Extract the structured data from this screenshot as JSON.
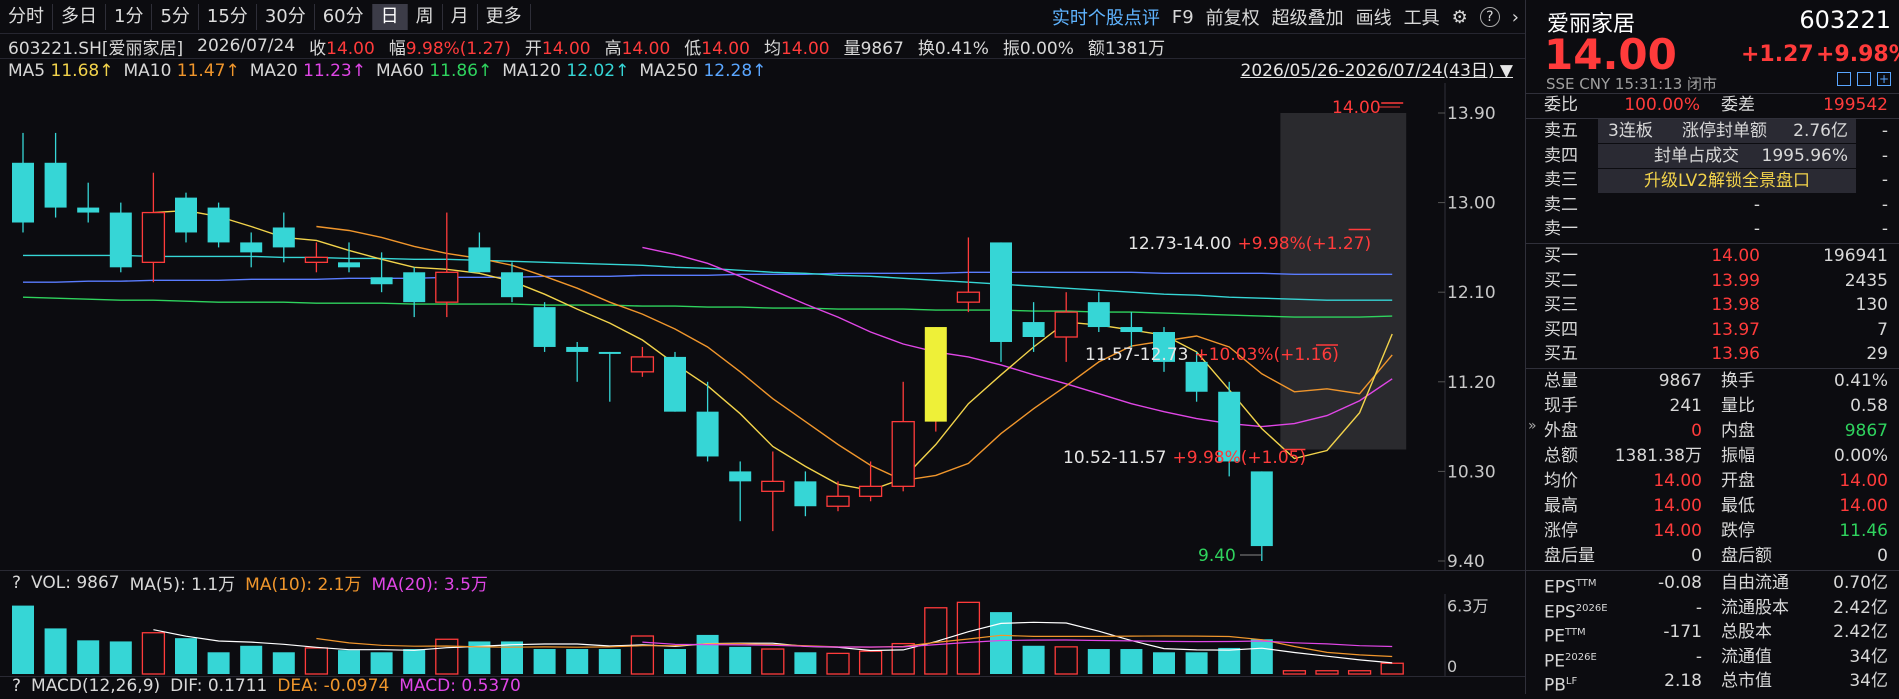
{
  "toolbar": {
    "periods": [
      "分时",
      "多日",
      "1分",
      "5分",
      "15分",
      "30分",
      "60分",
      "日",
      "周",
      "月",
      "更多"
    ],
    "active_period": "日",
    "right_items": [
      "实时个股点评",
      "F9",
      "前复权",
      "超级叠加",
      "画线",
      "工具"
    ]
  },
  "info": {
    "code": "603221.SH[爱丽家居]",
    "date": "2026/07/24",
    "close_label": "收",
    "close": "14.00",
    "amp_label": "幅",
    "amp": "9.98%(1.27)",
    "open_label": "开",
    "open": "14.00",
    "high_label": "高",
    "high": "14.00",
    "low_label": "低",
    "low": "14.00",
    "avg_label": "均",
    "avg": "14.00",
    "vol_label": "量",
    "vol": "9867",
    "turn_label": "换",
    "turn": "0.41%",
    "swing_label": "振",
    "swing": "0.00%",
    "amount_label": "额",
    "amount": "1381万"
  },
  "ma": {
    "ma5": "MA5",
    "ma5_val": "11.68↑",
    "ma10": "MA10",
    "ma10_val": "11.47↑",
    "ma20": "MA20",
    "ma20_val": "11.23↑",
    "ma60": "MA60",
    "ma60_val": "11.86↑",
    "ma120": "MA120",
    "ma120_val": "12.02↑",
    "ma250": "MA250",
    "ma250_val": "12.28↑",
    "range": "2026/05/26-2026/07/24(43日)"
  },
  "annotations": {
    "top": "14.00",
    "r1": "12.73-14.00",
    "r1p": "+9.98%(+1.27)",
    "r2": "11.57-12.73",
    "r2p": "+10.03%(+1.16)",
    "r3": "10.52-11.57",
    "r3p": "+9.98%(+1.05)",
    "bottom": "9.40"
  },
  "colors": {
    "up": "#ff3b3b",
    "down": "#36d6d6",
    "ma5": "#f2d34b",
    "ma10": "#f0962c",
    "ma20": "#e046e6",
    "ma60": "#2fd35e",
    "ma120": "#36d6d6",
    "ma250": "#5a7cff"
  },
  "chart_data": {
    "type": "candlestick",
    "y_ticks": [
      13.9,
      13.0,
      12.1,
      11.2,
      10.3,
      9.4
    ],
    "candles": [
      [
        13.4,
        12.8,
        13.7,
        12.7
      ],
      [
        13.4,
        12.95,
        13.7,
        12.85
      ],
      [
        12.95,
        12.9,
        13.2,
        12.8
      ],
      [
        12.9,
        12.35,
        13.0,
        12.3
      ],
      [
        12.4,
        12.9,
        13.3,
        12.2
      ],
      [
        13.05,
        12.7,
        13.1,
        12.6
      ],
      [
        12.95,
        12.6,
        13.0,
        12.55
      ],
      [
        12.6,
        12.5,
        12.7,
        12.35
      ],
      [
        12.75,
        12.55,
        12.9,
        12.4
      ],
      [
        12.4,
        12.45,
        12.6,
        12.3
      ],
      [
        12.4,
        12.35,
        12.6,
        12.3
      ],
      [
        12.25,
        12.18,
        12.5,
        12.1
      ],
      [
        12.3,
        12.0,
        12.35,
        11.85
      ],
      [
        12.0,
        12.3,
        12.9,
        11.85
      ],
      [
        12.55,
        12.3,
        12.7,
        12.3
      ],
      [
        12.3,
        12.05,
        12.4,
        12.0
      ],
      [
        11.95,
        11.55,
        12.0,
        11.5
      ],
      [
        11.55,
        11.5,
        11.6,
        11.2
      ],
      [
        11.5,
        11.48,
        11.5,
        11.0
      ],
      [
        11.3,
        11.45,
        11.55,
        11.25
      ],
      [
        11.45,
        10.9,
        11.5,
        10.9
      ],
      [
        10.9,
        10.45,
        11.2,
        10.4
      ],
      [
        10.3,
        10.2,
        10.4,
        9.8
      ],
      [
        10.1,
        10.2,
        10.5,
        9.7
      ],
      [
        10.2,
        9.95,
        10.3,
        9.85
      ],
      [
        9.95,
        10.05,
        10.2,
        9.9
      ],
      [
        10.05,
        10.15,
        10.4,
        10.0
      ],
      [
        10.15,
        10.8,
        11.2,
        10.1
      ],
      [
        10.8,
        11.75,
        11.75,
        10.7
      ],
      [
        12.0,
        12.1,
        12.65,
        11.9
      ],
      [
        12.6,
        11.6,
        12.6,
        11.4
      ],
      [
        11.8,
        11.65,
        12.0,
        11.5
      ],
      [
        11.65,
        11.9,
        12.1,
        11.4
      ],
      [
        12.0,
        11.75,
        12.1,
        11.7
      ],
      [
        11.75,
        11.7,
        11.9,
        11.55
      ],
      [
        11.7,
        11.4,
        11.75,
        11.3
      ],
      [
        11.4,
        11.1,
        11.5,
        11.0
      ],
      [
        11.1,
        10.4,
        11.2,
        10.25
      ],
      [
        10.3,
        9.55,
        10.3,
        9.4
      ],
      [
        10.52,
        10.52,
        10.52,
        10.52
      ],
      [
        11.57,
        11.57,
        11.57,
        11.57
      ],
      [
        12.73,
        12.73,
        12.73,
        12.73
      ],
      [
        14.0,
        14.0,
        14.0,
        14.0
      ]
    ],
    "special": {
      "index": 28,
      "color": "#eef038"
    },
    "ma5": [
      null,
      null,
      null,
      null,
      12.9,
      12.92,
      12.86,
      12.76,
      12.65,
      12.62,
      12.52,
      12.43,
      12.35,
      12.33,
      12.29,
      12.21,
      12.08,
      11.93,
      11.79,
      11.62,
      11.38,
      11.16,
      10.88,
      10.55,
      10.35,
      10.17,
      10.11,
      10.23,
      10.57,
      10.98,
      11.27,
      11.55,
      11.8,
      11.77,
      11.72,
      11.67,
      11.5,
      11.12,
      10.73,
      10.43,
      10.51,
      10.89,
      11.68
    ],
    "ma10": [
      null,
      null,
      null,
      null,
      null,
      null,
      null,
      null,
      null,
      12.76,
      12.72,
      12.65,
      12.56,
      12.49,
      12.44,
      12.37,
      12.26,
      12.14,
      12.0,
      11.88,
      11.73,
      11.55,
      11.3,
      11.03,
      10.8,
      10.57,
      10.36,
      10.21,
      10.26,
      10.38,
      10.68,
      10.93,
      11.16,
      11.4,
      11.56,
      11.61,
      11.66,
      11.55,
      11.28,
      11.1,
      11.13,
      11.08,
      11.47
    ],
    "ma20": [
      null,
      null,
      null,
      null,
      null,
      null,
      null,
      null,
      null,
      null,
      null,
      null,
      null,
      null,
      null,
      null,
      null,
      null,
      null,
      12.55,
      12.48,
      12.39,
      12.26,
      12.12,
      11.98,
      11.85,
      11.7,
      11.58,
      11.5,
      11.45,
      11.37,
      11.27,
      11.18,
      11.08,
      10.98,
      10.9,
      10.83,
      10.78,
      10.75,
      10.78,
      10.86,
      11.01,
      11.23
    ],
    "ma60": [
      12.05,
      12.04,
      12.03,
      12.02,
      12.02,
      12.01,
      12.0,
      12.0,
      12.0,
      11.99,
      11.99,
      11.99,
      11.98,
      11.98,
      11.98,
      11.98,
      11.97,
      11.97,
      11.97,
      11.96,
      11.96,
      11.95,
      11.95,
      11.94,
      11.94,
      11.93,
      11.93,
      11.93,
      11.92,
      11.92,
      11.92,
      11.91,
      11.91,
      11.9,
      11.9,
      11.89,
      11.88,
      11.87,
      11.86,
      11.85,
      11.85,
      11.85,
      11.86
    ],
    "ma120": [
      12.47,
      12.47,
      12.47,
      12.47,
      12.46,
      12.46,
      12.46,
      12.46,
      12.45,
      12.45,
      12.44,
      12.44,
      12.43,
      12.43,
      12.42,
      12.41,
      12.4,
      12.39,
      12.38,
      12.37,
      12.35,
      12.34,
      12.32,
      12.3,
      12.29,
      12.27,
      12.26,
      12.24,
      12.22,
      12.2,
      12.18,
      12.16,
      12.14,
      12.12,
      12.1,
      12.08,
      12.07,
      12.05,
      12.04,
      12.03,
      12.02,
      12.02,
      12.02
    ],
    "ma250": [
      12.2,
      12.2,
      12.21,
      12.21,
      12.22,
      12.22,
      12.22,
      12.23,
      12.23,
      12.23,
      12.24,
      12.24,
      12.24,
      12.25,
      12.25,
      12.25,
      12.26,
      12.26,
      12.26,
      12.27,
      12.27,
      12.27,
      12.28,
      12.28,
      12.28,
      12.29,
      12.29,
      12.29,
      12.29,
      12.3,
      12.3,
      12.3,
      12.3,
      12.3,
      12.3,
      12.29,
      12.29,
      12.29,
      12.29,
      12.28,
      12.28,
      12.28,
      12.28
    ],
    "volume": [
      6.3,
      4.2,
      3.1,
      3.0,
      3.8,
      3.3,
      2.0,
      2.6,
      2.0,
      2.4,
      2.2,
      2.0,
      2.3,
      3.2,
      3.0,
      3.0,
      2.3,
      2.3,
      2.3,
      3.5,
      2.3,
      3.6,
      2.5,
      2.3,
      2.0,
      1.9,
      2.1,
      2.8,
      6.1,
      6.6,
      5.7,
      2.6,
      2.5,
      2.3,
      2.3,
      2.0,
      2.0,
      2.4,
      3.2,
      0.3,
      0.3,
      0.3,
      0.99
    ],
    "vol_ticks": [
      "6.3万",
      "0"
    ]
  },
  "vol_info": {
    "label": "VOL: 9867",
    "ma5": "MA(5): 1.1万",
    "ma10": "MA(10): 2.1万",
    "ma20": "MA(20): 3.5万",
    "q": "?"
  },
  "macd_info": {
    "label": "MACD(12,26,9)",
    "dif": "DIF: 0.1711",
    "dea": "DEA: -0.0974",
    "macd": "MACD: 0.5370",
    "q": "?"
  },
  "stock": {
    "name": "爱丽家居",
    "code": "603221",
    "price": "14.00",
    "change": "+1.27",
    "pct": "+9.98%",
    "market": "SSE CNY 15:31:13 闭市"
  },
  "order_book": {
    "wb_label": "委比",
    "wb": "100.00%",
    "wc_label": "委差",
    "wc": "199542",
    "asks": [
      {
        "label": "卖五",
        "price": "-",
        "vol": "-"
      },
      {
        "label": "卖四",
        "price": "-",
        "vol": "-"
      },
      {
        "label": "卖三",
        "price": "-",
        "vol": "-"
      },
      {
        "label": "卖二",
        "price": "-",
        "vol": "-"
      },
      {
        "label": "卖一",
        "price": "-",
        "vol": "-"
      }
    ],
    "board": "3连板",
    "seal_label": "涨停封单额",
    "seal_amt": "2.76亿",
    "seal_ratio_label": "封单占成交",
    "seal_ratio": "1995.96%",
    "upgrade": "升级LV2解锁全景盘口",
    "bids": [
      {
        "label": "买一",
        "price": "14.00",
        "vol": "196941"
      },
      {
        "label": "买二",
        "price": "13.99",
        "vol": "2435"
      },
      {
        "label": "买三",
        "price": "13.98",
        "vol": "130"
      },
      {
        "label": "买四",
        "price": "13.97",
        "vol": "7"
      },
      {
        "label": "买五",
        "price": "13.96",
        "vol": "29"
      }
    ]
  },
  "stats": [
    {
      "l": "总量",
      "v": "9867",
      "l2": "换手",
      "v2": "0.41%"
    },
    {
      "l": "现手",
      "v": "241",
      "l2": "量比",
      "v2": "0.58"
    },
    {
      "l": "外盘",
      "v": "0",
      "l2": "内盘",
      "v2": "9867"
    },
    {
      "l": "总额",
      "v": "1381.38万",
      "l2": "振幅",
      "v2": "0.00%"
    },
    {
      "l": "均价",
      "v": "14.00",
      "l2": "开盘",
      "v2": "14.00"
    },
    {
      "l": "最高",
      "v": "14.00",
      "l2": "最低",
      "v2": "14.00"
    },
    {
      "l": "涨停",
      "v": "14.00",
      "l2": "跌停",
      "v2": "11.46"
    },
    {
      "l": "盘后量",
      "v": "0",
      "l2": "盘后额",
      "v2": "0"
    }
  ],
  "fin": [
    {
      "l": "EPS",
      "sup": "TTM",
      "v": "-0.08",
      "l2": "自由流通",
      "v2": "0.70亿"
    },
    {
      "l": "EPS",
      "sup": "2026E",
      "v": "-",
      "l2": "流通股本",
      "v2": "2.42亿"
    },
    {
      "l": "PE",
      "sup": "TTM",
      "v": "-171",
      "l2": "总股本",
      "v2": "2.42亿"
    },
    {
      "l": "PE",
      "sup": "2026E",
      "v": "-",
      "l2": "流通值",
      "v2": "34亿"
    },
    {
      "l": "PB",
      "sup": "LF",
      "v": "2.18",
      "l2": "总市值",
      "v2": "34亿"
    }
  ]
}
